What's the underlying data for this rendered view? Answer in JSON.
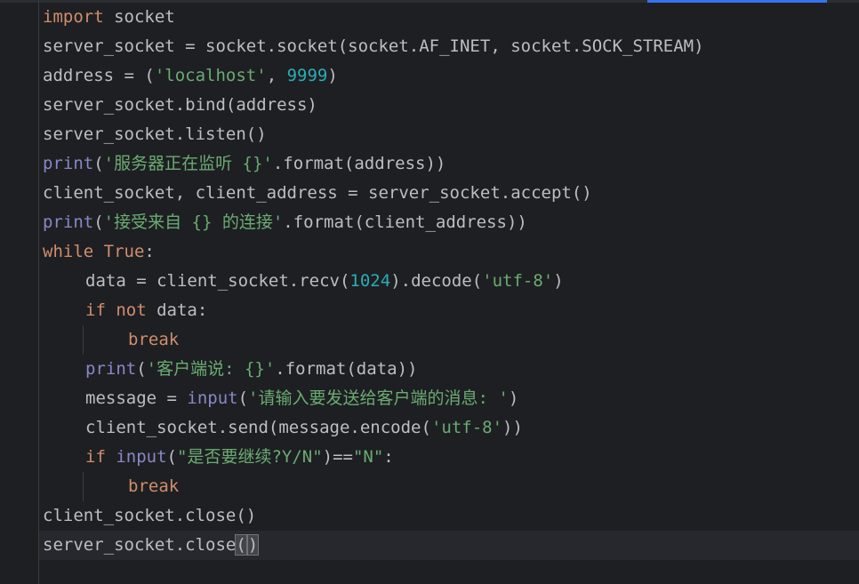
{
  "colors": {
    "background": "#1e1f22",
    "keyword": "#cf8e6d",
    "builtin": "#8888c6",
    "string": "#6aab73",
    "number": "#2aacb8",
    "text": "#bcbec4",
    "accent": "#3574f0"
  },
  "code": {
    "l1": {
      "kw": "import",
      "rest": " socket"
    },
    "l2": {
      "a": "server_socket = socket.socket(socket.AF_INET, socket.SOCK_STREAM)"
    },
    "l3": {
      "a": "address = (",
      "s": "'localhost'",
      "b": ", ",
      "n": "9999",
      "c": ")"
    },
    "l4": {
      "a": "server_socket.bind(address)"
    },
    "l5": {
      "a": "server_socket.listen()"
    },
    "l6": {
      "fn": "print",
      "a": "(",
      "s": "'服务器正在监听 {}'",
      "b": ".format(address))"
    },
    "l7": {
      "a": "client_socket, client_address = server_socket.accept()"
    },
    "l8": {
      "fn": "print",
      "a": "(",
      "s": "'接受来自 {} 的连接'",
      "b": ".format(client_address))"
    },
    "l9": {
      "kw": "while",
      "sp": " ",
      "kw2": "True",
      "rest": ":"
    },
    "l10": {
      "a": "data = client_socket.recv(",
      "n": "1024",
      "b": ").decode(",
      "s": "'utf-8'",
      "c": ")"
    },
    "l11": {
      "kw": "if",
      "sp": " ",
      "kw2": "not",
      "rest": " data:"
    },
    "l12": {
      "kw": "break"
    },
    "l13": {
      "fn": "print",
      "a": "(",
      "s": "'客户端说: {}'",
      "b": ".format(data))"
    },
    "l14": {
      "a": "message = ",
      "fn": "input",
      "b": "(",
      "s": "'请输入要发送给客户端的消息: '",
      "c": ")"
    },
    "l15": {
      "a": "client_socket.send(message.encode(",
      "s": "'utf-8'",
      "c": "))"
    },
    "l16": {
      "kw": "if",
      "sp": " ",
      "fn": "input",
      "a": "(",
      "s": "\"是否要继续?Y/N\"",
      "b": ")==",
      "s2": "\"N\"",
      "c": ":"
    },
    "l17": {
      "kw": "break"
    },
    "l18": {
      "a": "client_socket.close()"
    },
    "l19": {
      "a": "server_socket.close",
      "p1": "(",
      "p2": ")"
    }
  }
}
